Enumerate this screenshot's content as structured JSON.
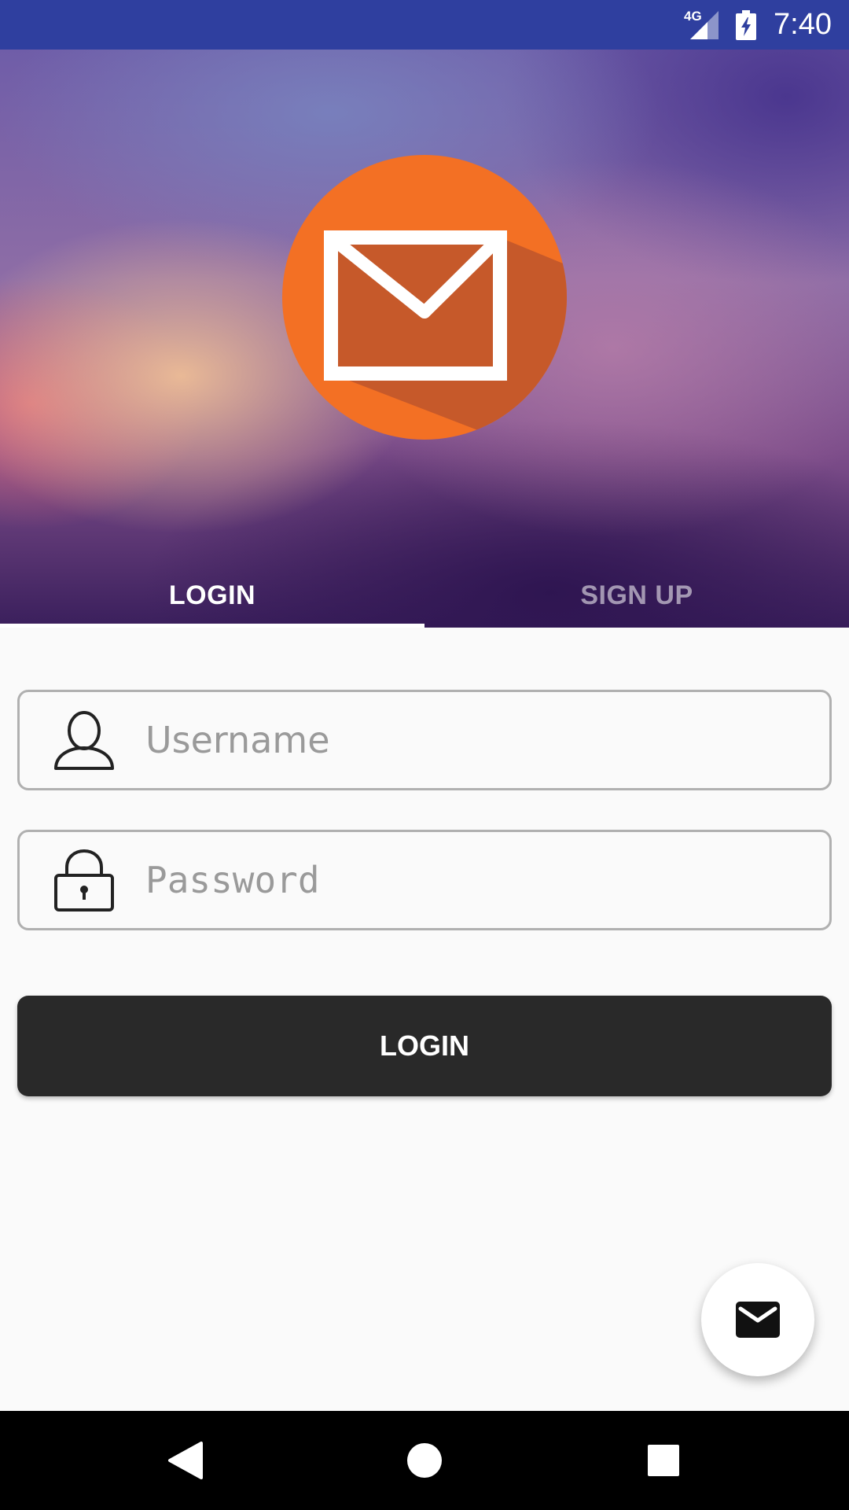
{
  "status_bar": {
    "network": "4G",
    "time": "7:40"
  },
  "header": {
    "logo_icon": "mail-envelope-icon",
    "colors": {
      "logo_circle": "#f37024",
      "logo_shadow": "#c6592a",
      "envelope": "#ffffff"
    }
  },
  "tabs": [
    {
      "label": "LOGIN",
      "active": true
    },
    {
      "label": "SIGN UP",
      "active": false
    }
  ],
  "form": {
    "username": {
      "value": "",
      "placeholder": "Username",
      "icon": "user-icon"
    },
    "password": {
      "value": "",
      "placeholder": "Password",
      "icon": "lock-icon"
    },
    "login_button_label": "LOGIN"
  },
  "fab": {
    "icon": "mail-icon"
  },
  "nav_bar": {
    "back": "back-icon",
    "home": "home-icon",
    "recents": "recents-icon"
  },
  "colors": {
    "status_bar": "#2f3f9f",
    "button": "#292929",
    "background": "#fafafa"
  }
}
